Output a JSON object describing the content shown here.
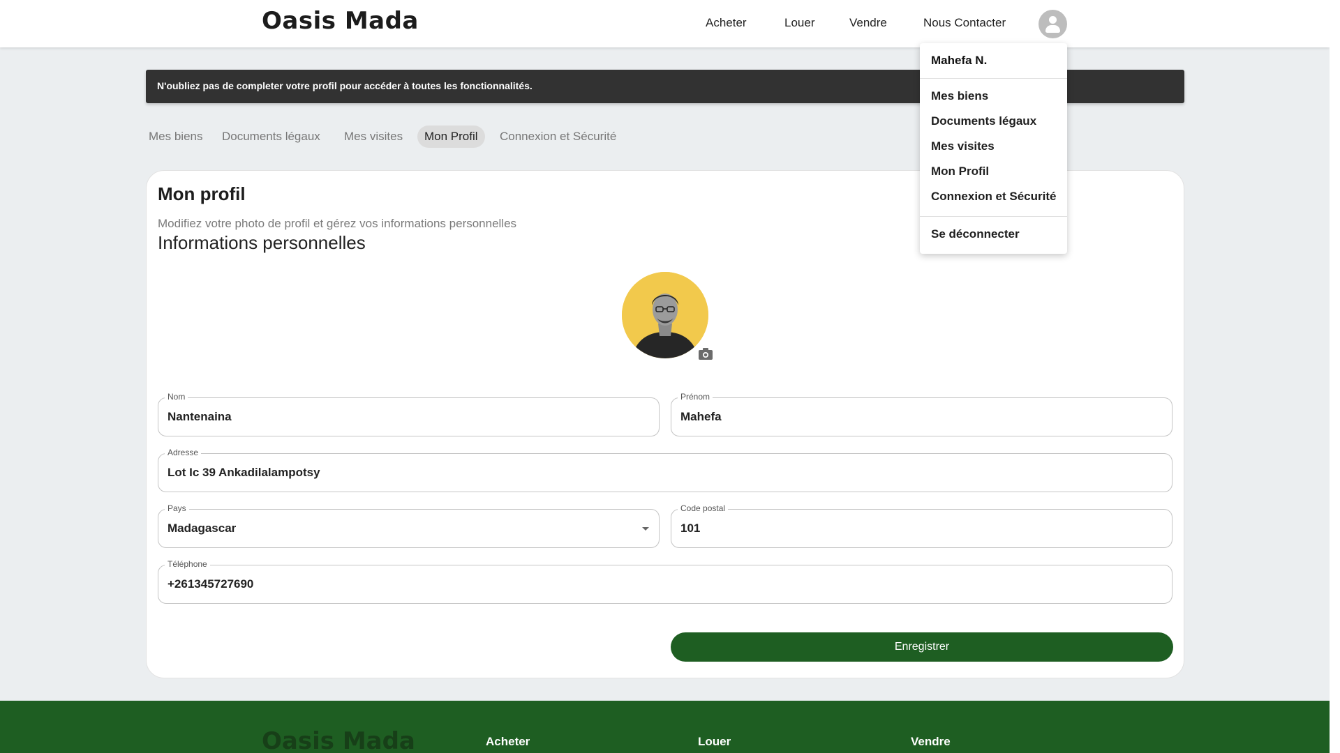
{
  "header": {
    "logo": "Oasis Mada",
    "nav": [
      "Acheter",
      "Louer",
      "Vendre",
      "Nous Contacter"
    ],
    "avatar_icon": "account-circle-icon"
  },
  "user_menu": {
    "user_name": "Mahefa N.",
    "items": [
      "Mes biens",
      "Documents légaux",
      "Mes visites",
      "Mon Profil",
      "Connexion et Sécurité"
    ],
    "logout": "Se déconnecter"
  },
  "alert": {
    "message": "N'oubliez pas de completer votre profil pour accéder à toutes les fonctionnalités."
  },
  "tabs": {
    "items": [
      "Mes biens",
      "Documents légaux",
      "Mes visites",
      "Mon Profil",
      "Connexion et Sécurité"
    ],
    "active": "Mon Profil"
  },
  "profile": {
    "title": "Mon profil",
    "subtitle": "Modifiez votre photo de profil et gérez vos informations personnelles",
    "section_title": "Informations personnelles",
    "camera_icon": "camera-icon",
    "fields": {
      "nom": {
        "label": "Nom",
        "value": "Nantenaina"
      },
      "prenom": {
        "label": "Prénom",
        "value": "Mahefa"
      },
      "adresse": {
        "label": "Adresse",
        "value": "Lot Ic 39 Ankadilalampotsy"
      },
      "pays": {
        "label": "Pays",
        "value": "Madagascar"
      },
      "code_postal": {
        "label": "Code postal",
        "value": "101"
      },
      "telephone": {
        "label": "Téléphone",
        "value": "+261345727690"
      }
    },
    "save_label": "Enregistrer"
  },
  "footer": {
    "logo": "Oasis Mada",
    "links": [
      "Acheter",
      "Louer",
      "Vendre"
    ]
  },
  "colors": {
    "primary_green": "#1e5e22",
    "alert_bg": "#323232",
    "page_bg": "#ebeef0",
    "avatar_bg": "#f2c94c"
  }
}
